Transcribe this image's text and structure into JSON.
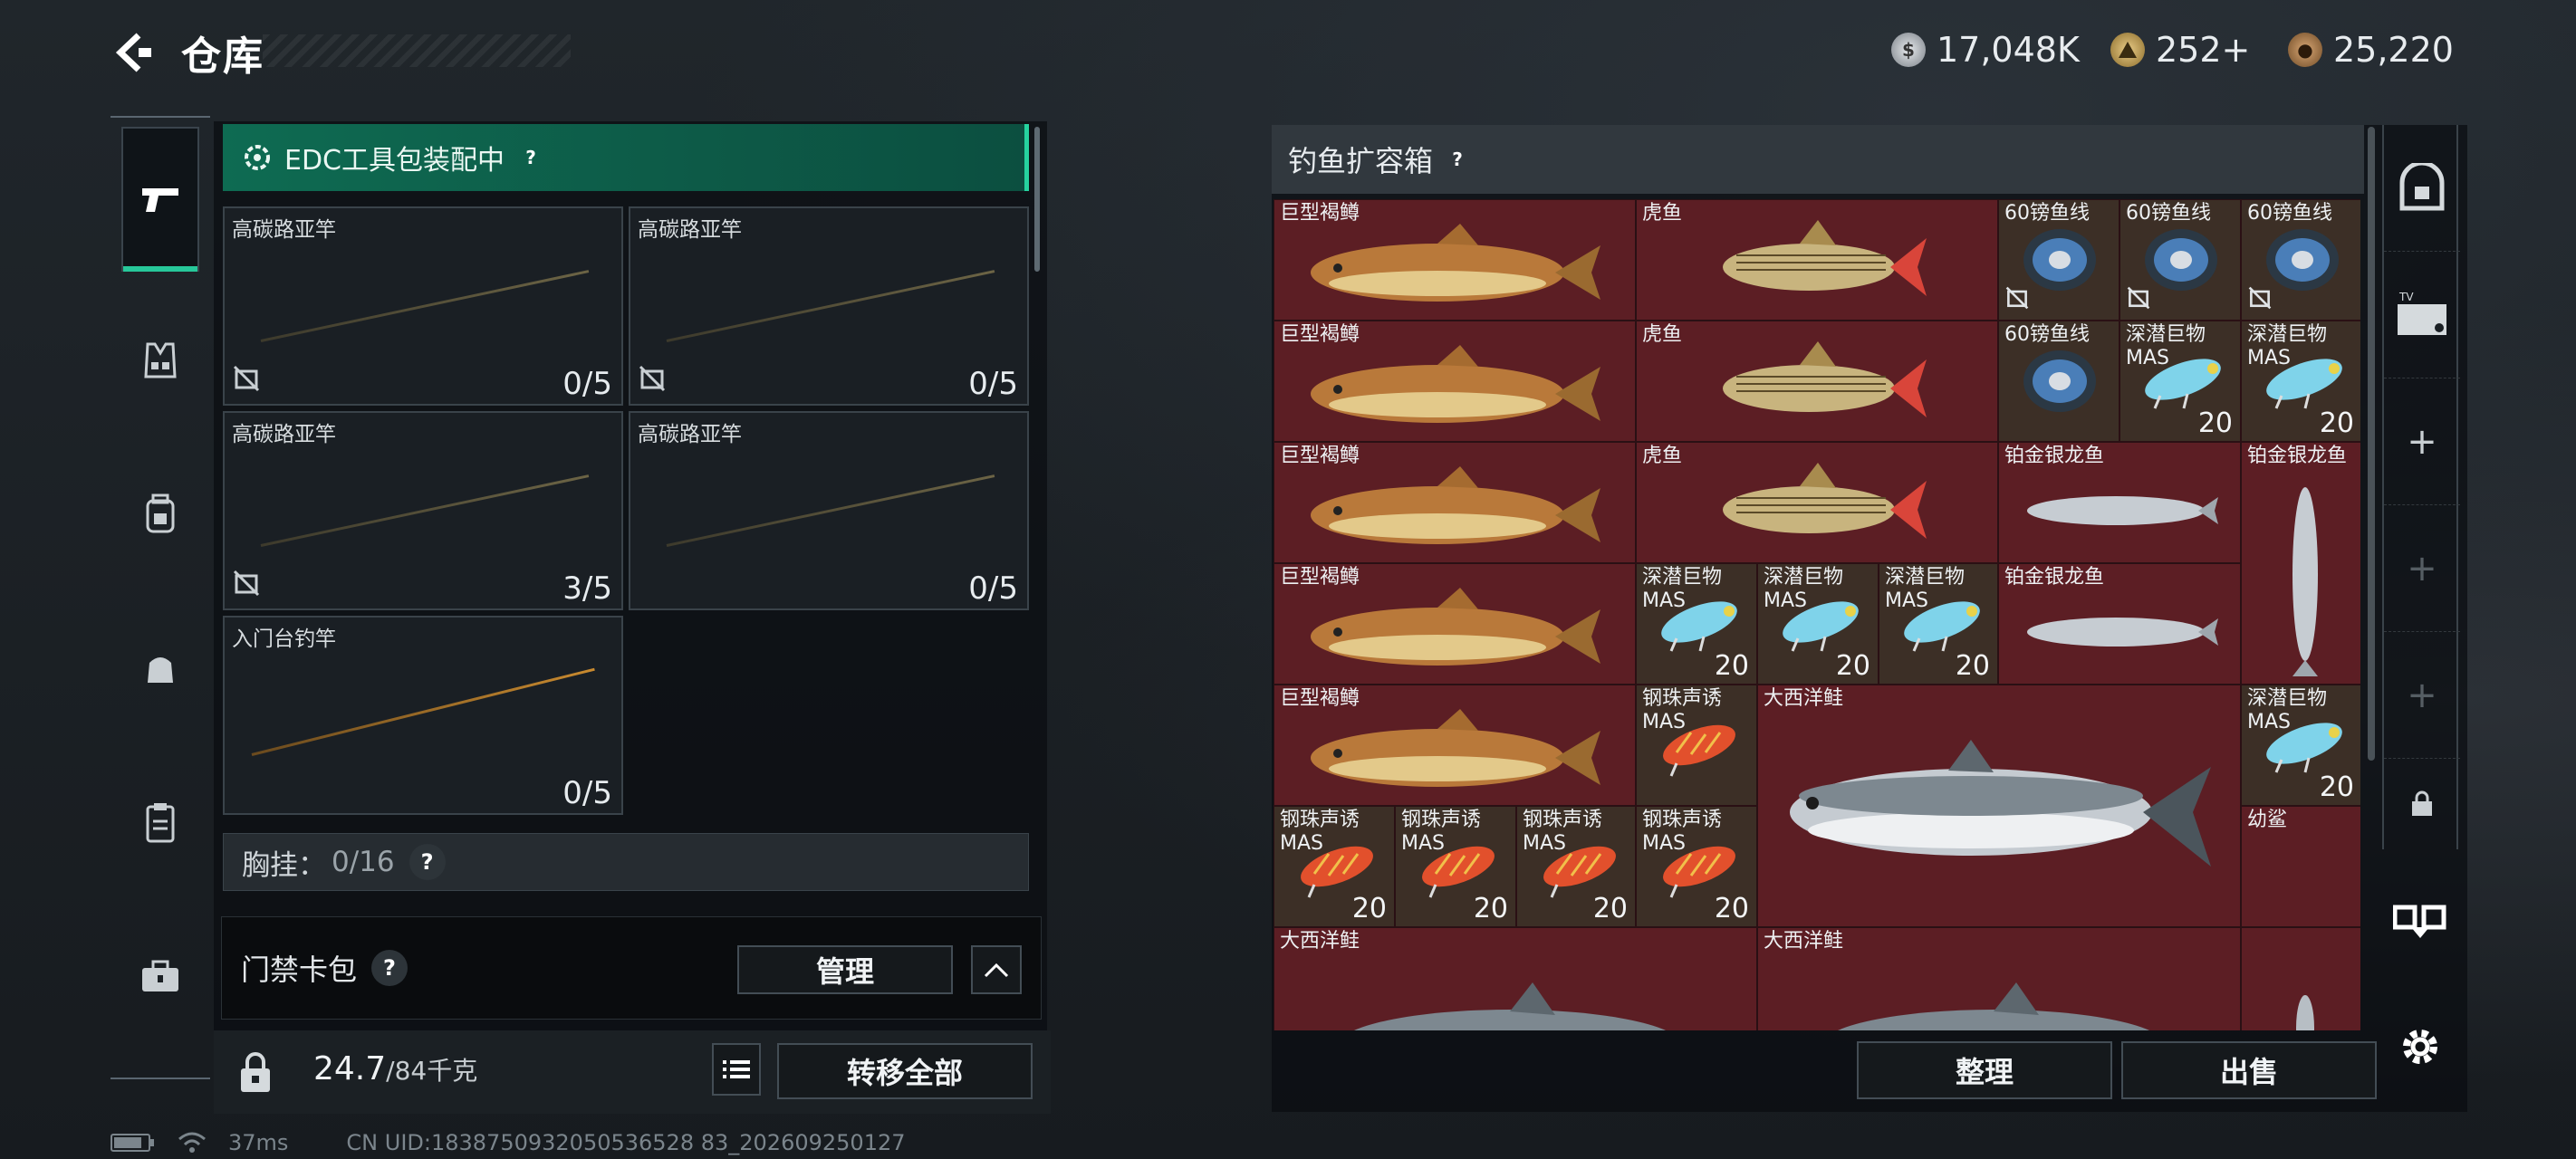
{
  "header": {
    "title": "仓库",
    "currencies": [
      {
        "icon": "silver-coin-icon",
        "value": "17,048K"
      },
      {
        "icon": "gold-triangle-icon",
        "value": "252+"
      },
      {
        "icon": "bronze-coin-icon",
        "value": "25,220"
      }
    ]
  },
  "left": {
    "edc_label": "EDC工具包装配中",
    "slots": [
      {
        "name": "高碳路亚竿",
        "count": "0/5"
      },
      {
        "name": "高碳路亚竿",
        "count": "0/5"
      },
      {
        "name": "高碳路亚竿",
        "count": "3/5"
      },
      {
        "name": "高碳路亚竿",
        "count": "0/5"
      },
      {
        "name": "入门台钓竿",
        "count": "0/5"
      }
    ],
    "chest_label": "胸挂：",
    "chest_value": "0/16",
    "access_label": "门禁卡包",
    "manage_label": "管理",
    "weight_value": "24.7",
    "weight_max": "/84千克",
    "transfer_all_label": "转移全部"
  },
  "right": {
    "box_title": "钓鱼扩容箱",
    "sort_label": "整理",
    "sell_label": "出售",
    "items": {
      "trout": "巨型褐鳟",
      "tiger": "虎鱼",
      "line": "60镑鱼线",
      "deep": "深潜巨物",
      "mas": "MAS",
      "arowana": "铂金银龙鱼",
      "steel": "钢珠声诱",
      "salmon": "大西洋鲑",
      "shark": "幼鲨",
      "count20": "20"
    }
  },
  "status": {
    "ping": "37ms",
    "uid": "CN UID:1838750932050536528 83_202609250127"
  },
  "colors": {
    "accent": "#27c89a",
    "cell_red": "#5c1e24",
    "cell_brown": "#3c2f26"
  }
}
